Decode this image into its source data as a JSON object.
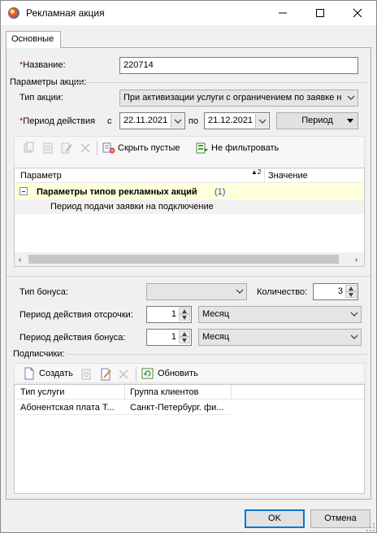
{
  "window": {
    "title": "Рекламная акция"
  },
  "tabs": [
    {
      "label": "Основные",
      "active": true
    }
  ],
  "form": {
    "name_label": "Название:",
    "name_value": "220714",
    "params_group_label": "Параметры акции:",
    "action_type_label": "Тип акции:",
    "action_type_value": "При активизации услуги с ограничением по заявке н",
    "period_label": "Период действия",
    "from_label": "с",
    "date_from": "22.11.2021",
    "to_label": "по",
    "date_to": "21.12.2021",
    "period_button": "Период"
  },
  "params_toolbar": {
    "hide_empty_label": "Скрыть пустые",
    "no_filter_label": "Не фильтровать"
  },
  "params_grid": {
    "col_param": "Параметр",
    "col_value": "Значение",
    "group_title": "Параметры типов рекламных акций",
    "group_count": "(1)",
    "rows": [
      {
        "param": "Период подачи заявки на подключение",
        "value": ""
      }
    ]
  },
  "bonus": {
    "type_label": "Тип бонуса:",
    "type_value": "",
    "qty_label": "Количество:",
    "qty_value": "3",
    "delay_label": "Период действия отсрочки:",
    "delay_value": "1",
    "delay_unit": "Месяц",
    "bonus_period_label": "Период действия бонуса:",
    "bonus_period_value": "1",
    "bonus_period_unit": "Месяц"
  },
  "subscribers": {
    "group_label": "Подписчики:",
    "create_label": "Создать",
    "refresh_label": "Обновить",
    "col_service": "Тип услуги",
    "col_client_group": "Группа клиентов",
    "rows": [
      {
        "service": "Абонентская плата Т...",
        "client_group": "Санкт-Петербург. фи..."
      }
    ]
  },
  "footer": {
    "ok_label": "OK",
    "cancel_label": "Отмена"
  },
  "colors": {
    "highlight_row": "#ffffdc",
    "accent": "#0078d7"
  }
}
